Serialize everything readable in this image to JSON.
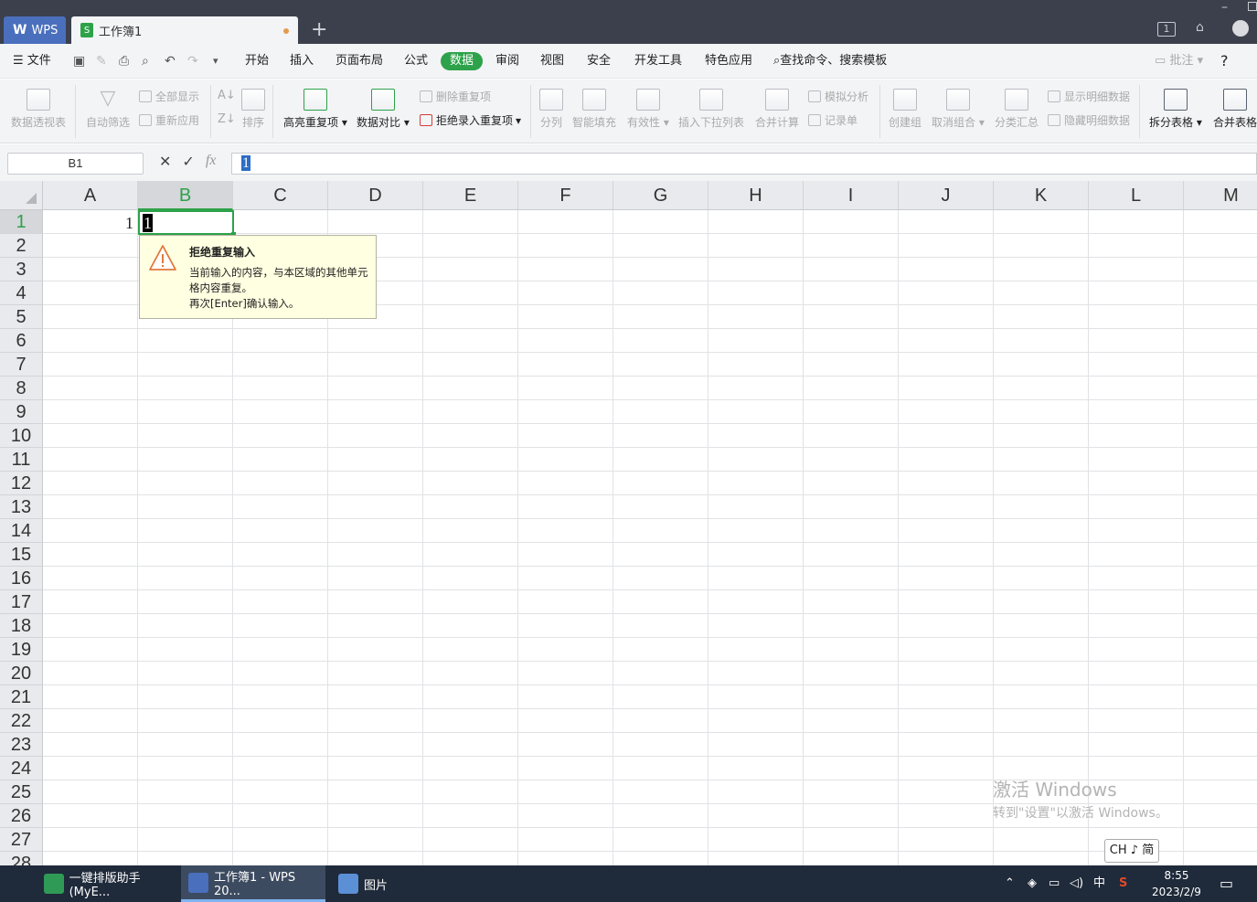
{
  "titlebar": {
    "wps_label": "WPS",
    "doc_tab_label": "工作簿1",
    "new_tab": "+",
    "badge": "1"
  },
  "menu": {
    "file": "文件",
    "tabs": [
      "开始",
      "插入",
      "页面布局",
      "公式",
      "数据",
      "审阅",
      "视图",
      "安全",
      "开发工具",
      "特色应用"
    ],
    "active_tab": "数据",
    "search": "查找命令、搜索模板",
    "comment": "批注",
    "help": "?"
  },
  "ribbon": {
    "pivot": "数据透视表",
    "autofilter": "自动筛选",
    "show_all": "全部显示",
    "reapply": "重新应用",
    "sort": "排序",
    "highlight_dup": "高亮重复项",
    "compare": "数据对比",
    "delete_dup": "删除重复项",
    "reject_dup": "拒绝录入重复项",
    "split_col": "分列",
    "smart_fill": "智能填充",
    "validity": "有效性",
    "insert_dropdown": "插入下拉列表",
    "consolidate": "合并计算",
    "simulate": "模拟分析",
    "record": "记录单",
    "create_group": "创建组",
    "ungroup": "取消组合",
    "subtotal": "分类汇总",
    "show_detail": "显示明细数据",
    "hide_detail": "隐藏明细数据",
    "split_table": "拆分表格",
    "merge_table": "合并表格"
  },
  "formula_bar": {
    "name_box": "B1",
    "fx": "fx",
    "value": "1"
  },
  "sheet": {
    "columns": [
      "A",
      "B",
      "C",
      "D",
      "E",
      "F",
      "G",
      "H",
      "I",
      "J",
      "K",
      "L",
      "M"
    ],
    "rows": [
      "1",
      "2",
      "3",
      "4",
      "5",
      "6",
      "7",
      "8",
      "9",
      "10",
      "11",
      "12",
      "13",
      "14",
      "15",
      "16",
      "17",
      "18",
      "19",
      "20",
      "21",
      "22",
      "23",
      "24",
      "25",
      "26",
      "27",
      "28"
    ],
    "selected_column": "B",
    "selected_row": "1",
    "cell_A1": "1",
    "cell_B1_editing": "1"
  },
  "tooltip": {
    "title": "拒绝重复输入",
    "line1": "当前输入的内容，与本区域的其他单元格内容重复。",
    "line2": "再次[Enter]确认输入。"
  },
  "watermark": {
    "line1": "激活 Windows",
    "line2": "转到\"设置\"以激活 Windows。"
  },
  "ime": "CH ♪ 简",
  "taskbar": {
    "items": [
      "一键排版助手(MyE...",
      "工作簿1 - WPS 20...",
      "图片"
    ],
    "tray_lang": "中",
    "time": "8:55",
    "date": "2023/2/9"
  },
  "colors": {
    "accent": "#2da24a",
    "wps_blue": "#4a6fbd",
    "titlebar": "#3b404c",
    "taskbar": "#1f2a3a"
  }
}
